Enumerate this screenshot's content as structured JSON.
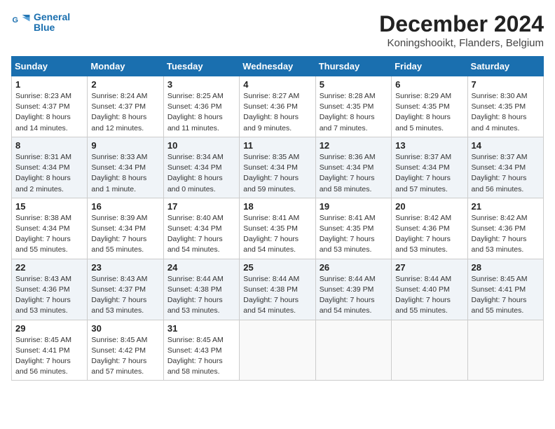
{
  "header": {
    "logo_line1": "General",
    "logo_line2": "Blue",
    "month_title": "December 2024",
    "location": "Koningshooikt, Flanders, Belgium"
  },
  "weekdays": [
    "Sunday",
    "Monday",
    "Tuesday",
    "Wednesday",
    "Thursday",
    "Friday",
    "Saturday"
  ],
  "weeks": [
    [
      {
        "day": "1",
        "info": "Sunrise: 8:23 AM\nSunset: 4:37 PM\nDaylight: 8 hours\nand 14 minutes."
      },
      {
        "day": "2",
        "info": "Sunrise: 8:24 AM\nSunset: 4:37 PM\nDaylight: 8 hours\nand 12 minutes."
      },
      {
        "day": "3",
        "info": "Sunrise: 8:25 AM\nSunset: 4:36 PM\nDaylight: 8 hours\nand 11 minutes."
      },
      {
        "day": "4",
        "info": "Sunrise: 8:27 AM\nSunset: 4:36 PM\nDaylight: 8 hours\nand 9 minutes."
      },
      {
        "day": "5",
        "info": "Sunrise: 8:28 AM\nSunset: 4:35 PM\nDaylight: 8 hours\nand 7 minutes."
      },
      {
        "day": "6",
        "info": "Sunrise: 8:29 AM\nSunset: 4:35 PM\nDaylight: 8 hours\nand 5 minutes."
      },
      {
        "day": "7",
        "info": "Sunrise: 8:30 AM\nSunset: 4:35 PM\nDaylight: 8 hours\nand 4 minutes."
      }
    ],
    [
      {
        "day": "8",
        "info": "Sunrise: 8:31 AM\nSunset: 4:34 PM\nDaylight: 8 hours\nand 2 minutes."
      },
      {
        "day": "9",
        "info": "Sunrise: 8:33 AM\nSunset: 4:34 PM\nDaylight: 8 hours\nand 1 minute."
      },
      {
        "day": "10",
        "info": "Sunrise: 8:34 AM\nSunset: 4:34 PM\nDaylight: 8 hours\nand 0 minutes."
      },
      {
        "day": "11",
        "info": "Sunrise: 8:35 AM\nSunset: 4:34 PM\nDaylight: 7 hours\nand 59 minutes."
      },
      {
        "day": "12",
        "info": "Sunrise: 8:36 AM\nSunset: 4:34 PM\nDaylight: 7 hours\nand 58 minutes."
      },
      {
        "day": "13",
        "info": "Sunrise: 8:37 AM\nSunset: 4:34 PM\nDaylight: 7 hours\nand 57 minutes."
      },
      {
        "day": "14",
        "info": "Sunrise: 8:37 AM\nSunset: 4:34 PM\nDaylight: 7 hours\nand 56 minutes."
      }
    ],
    [
      {
        "day": "15",
        "info": "Sunrise: 8:38 AM\nSunset: 4:34 PM\nDaylight: 7 hours\nand 55 minutes."
      },
      {
        "day": "16",
        "info": "Sunrise: 8:39 AM\nSunset: 4:34 PM\nDaylight: 7 hours\nand 55 minutes."
      },
      {
        "day": "17",
        "info": "Sunrise: 8:40 AM\nSunset: 4:34 PM\nDaylight: 7 hours\nand 54 minutes."
      },
      {
        "day": "18",
        "info": "Sunrise: 8:41 AM\nSunset: 4:35 PM\nDaylight: 7 hours\nand 54 minutes."
      },
      {
        "day": "19",
        "info": "Sunrise: 8:41 AM\nSunset: 4:35 PM\nDaylight: 7 hours\nand 53 minutes."
      },
      {
        "day": "20",
        "info": "Sunrise: 8:42 AM\nSunset: 4:36 PM\nDaylight: 7 hours\nand 53 minutes."
      },
      {
        "day": "21",
        "info": "Sunrise: 8:42 AM\nSunset: 4:36 PM\nDaylight: 7 hours\nand 53 minutes."
      }
    ],
    [
      {
        "day": "22",
        "info": "Sunrise: 8:43 AM\nSunset: 4:36 PM\nDaylight: 7 hours\nand 53 minutes."
      },
      {
        "day": "23",
        "info": "Sunrise: 8:43 AM\nSunset: 4:37 PM\nDaylight: 7 hours\nand 53 minutes."
      },
      {
        "day": "24",
        "info": "Sunrise: 8:44 AM\nSunset: 4:38 PM\nDaylight: 7 hours\nand 53 minutes."
      },
      {
        "day": "25",
        "info": "Sunrise: 8:44 AM\nSunset: 4:38 PM\nDaylight: 7 hours\nand 54 minutes."
      },
      {
        "day": "26",
        "info": "Sunrise: 8:44 AM\nSunset: 4:39 PM\nDaylight: 7 hours\nand 54 minutes."
      },
      {
        "day": "27",
        "info": "Sunrise: 8:44 AM\nSunset: 4:40 PM\nDaylight: 7 hours\nand 55 minutes."
      },
      {
        "day": "28",
        "info": "Sunrise: 8:45 AM\nSunset: 4:41 PM\nDaylight: 7 hours\nand 55 minutes."
      }
    ],
    [
      {
        "day": "29",
        "info": "Sunrise: 8:45 AM\nSunset: 4:41 PM\nDaylight: 7 hours\nand 56 minutes."
      },
      {
        "day": "30",
        "info": "Sunrise: 8:45 AM\nSunset: 4:42 PM\nDaylight: 7 hours\nand 57 minutes."
      },
      {
        "day": "31",
        "info": "Sunrise: 8:45 AM\nSunset: 4:43 PM\nDaylight: 7 hours\nand 58 minutes."
      },
      null,
      null,
      null,
      null
    ]
  ]
}
